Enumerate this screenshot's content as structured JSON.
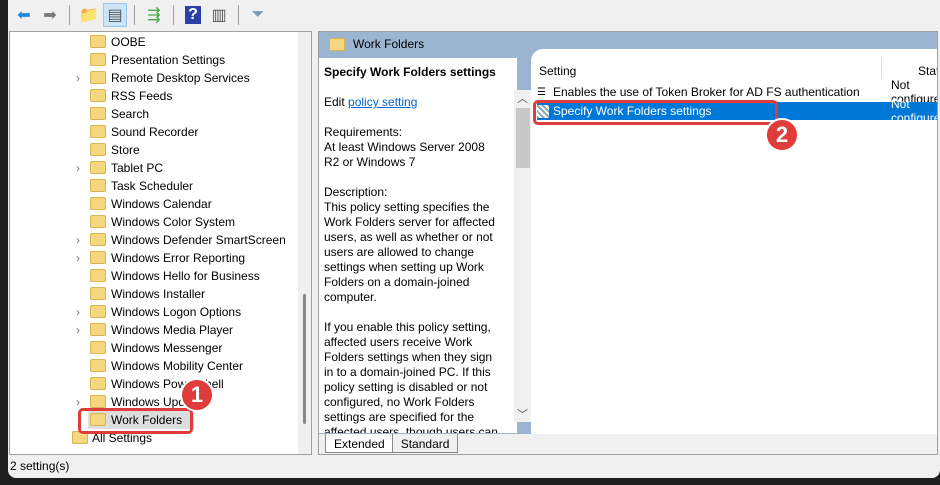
{
  "toolbar": {
    "buttons": [
      "back-icon",
      "forward-icon",
      "up-folder-icon",
      "show-hide-tree-icon",
      "export-list-icon",
      "help-icon",
      "show-action-pane-icon",
      "filter-icon"
    ]
  },
  "tree": {
    "items": [
      {
        "label": "OOBE",
        "chevron": false
      },
      {
        "label": "Presentation Settings",
        "chevron": false
      },
      {
        "label": "Remote Desktop Services",
        "chevron": true
      },
      {
        "label": "RSS Feeds",
        "chevron": false
      },
      {
        "label": "Search",
        "chevron": false
      },
      {
        "label": "Sound Recorder",
        "chevron": false
      },
      {
        "label": "Store",
        "chevron": false
      },
      {
        "label": "Tablet PC",
        "chevron": true
      },
      {
        "label": "Task Scheduler",
        "chevron": false
      },
      {
        "label": "Windows Calendar",
        "chevron": false
      },
      {
        "label": "Windows Color System",
        "chevron": false
      },
      {
        "label": "Windows Defender SmartScreen",
        "chevron": true
      },
      {
        "label": "Windows Error Reporting",
        "chevron": true
      },
      {
        "label": "Windows Hello for Business",
        "chevron": false
      },
      {
        "label": "Windows Installer",
        "chevron": false
      },
      {
        "label": "Windows Logon Options",
        "chevron": true
      },
      {
        "label": "Windows Media Player",
        "chevron": true
      },
      {
        "label": "Windows Messenger",
        "chevron": false
      },
      {
        "label": "Windows Mobility Center",
        "chevron": false
      },
      {
        "label": "Windows PowerShell",
        "chevron": false
      },
      {
        "label": "Windows Update",
        "chevron": true
      },
      {
        "label": "Work Folders",
        "chevron": false
      }
    ],
    "all_settings": "All Settings"
  },
  "header": {
    "title": "Work Folders"
  },
  "description": {
    "title": "Specify Work Folders settings",
    "edit_prefix": "Edit ",
    "edit_link": "policy setting",
    "requirements": "Requirements:\nAt least Windows Server 2008 R2 or Windows 7",
    "description": "Description:\nThis policy setting specifies the Work Folders server for affected users, as well as whether or not users are allowed to change settings when setting up Work Folders on a domain-joined computer.",
    "more": "If you enable this policy setting, affected users receive Work Folders settings when they sign in to a domain-joined PC. If this policy setting is disabled or not configured, no Work Folders settings are specified for the affected users, though users can"
  },
  "list": {
    "col_setting": "Setting",
    "col_state": "State",
    "rows": [
      {
        "name": "Enables the use of Token Broker for AD FS authentication",
        "state": "Not configured"
      },
      {
        "name": "Specify Work Folders settings",
        "state": "Not configured"
      }
    ]
  },
  "tabs": [
    "Extended",
    "Standard"
  ],
  "status": "2 setting(s)",
  "annotations": [
    "1",
    "2"
  ]
}
